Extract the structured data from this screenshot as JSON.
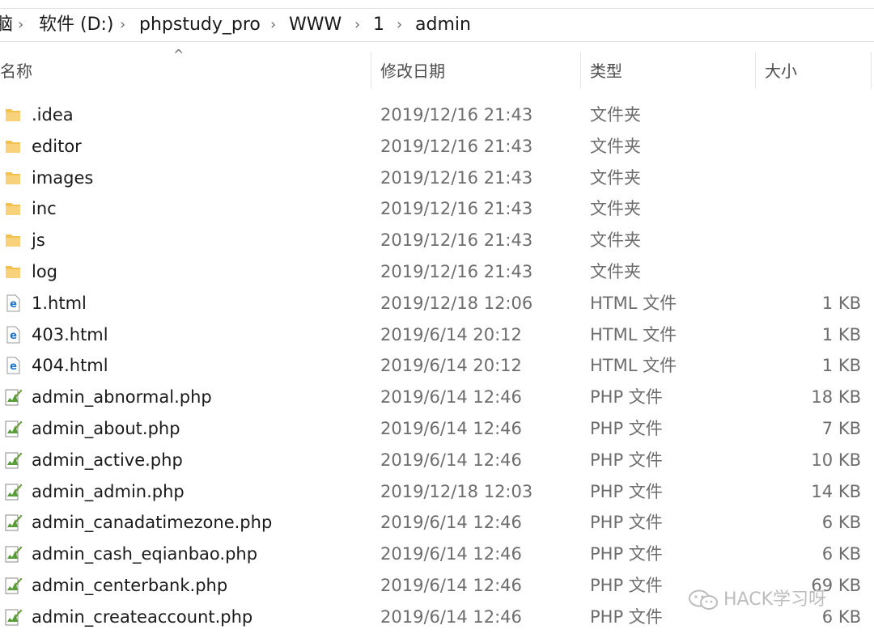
{
  "breadcrumb": {
    "items": [
      {
        "label": "脑"
      },
      {
        "label": "软件 (D:)"
      },
      {
        "label": "phpstudy_pro"
      },
      {
        "label": "WWW"
      },
      {
        "label": "1"
      },
      {
        "label": "admin"
      }
    ],
    "separator": "›"
  },
  "columns": {
    "name": "名称",
    "date": "修改日期",
    "type": "类型",
    "size": "大小"
  },
  "sort_indicator": "^",
  "files": [
    {
      "name": ".idea",
      "date": "2019/12/16 21:43",
      "type": "文件夹",
      "size": "",
      "icon": "folder-icon"
    },
    {
      "name": "editor",
      "date": "2019/12/16 21:43",
      "type": "文件夹",
      "size": "",
      "icon": "folder-icon"
    },
    {
      "name": "images",
      "date": "2019/12/16 21:43",
      "type": "文件夹",
      "size": "",
      "icon": "folder-icon"
    },
    {
      "name": "inc",
      "date": "2019/12/16 21:43",
      "type": "文件夹",
      "size": "",
      "icon": "folder-icon"
    },
    {
      "name": "js",
      "date": "2019/12/16 21:43",
      "type": "文件夹",
      "size": "",
      "icon": "folder-icon"
    },
    {
      "name": "log",
      "date": "2019/12/16 21:43",
      "type": "文件夹",
      "size": "",
      "icon": "folder-icon"
    },
    {
      "name": "1.html",
      "date": "2019/12/18 12:06",
      "type": "HTML 文件",
      "size": "1 KB",
      "icon": "html-file-icon"
    },
    {
      "name": "403.html",
      "date": "2019/6/14 20:12",
      "type": "HTML 文件",
      "size": "1 KB",
      "icon": "html-file-icon"
    },
    {
      "name": "404.html",
      "date": "2019/6/14 20:12",
      "type": "HTML 文件",
      "size": "1 KB",
      "icon": "html-file-icon"
    },
    {
      "name": "admin_abnormal.php",
      "date": "2019/6/14 12:46",
      "type": "PHP 文件",
      "size": "18 KB",
      "icon": "php-file-icon"
    },
    {
      "name": "admin_about.php",
      "date": "2019/6/14 12:46",
      "type": "PHP 文件",
      "size": "7 KB",
      "icon": "php-file-icon"
    },
    {
      "name": "admin_active.php",
      "date": "2019/6/14 12:46",
      "type": "PHP 文件",
      "size": "10 KB",
      "icon": "php-file-icon"
    },
    {
      "name": "admin_admin.php",
      "date": "2019/12/18 12:03",
      "type": "PHP 文件",
      "size": "14 KB",
      "icon": "php-file-icon"
    },
    {
      "name": "admin_canadatimezone.php",
      "date": "2019/6/14 12:46",
      "type": "PHP 文件",
      "size": "6 KB",
      "icon": "php-file-icon"
    },
    {
      "name": "admin_cash_eqianbao.php",
      "date": "2019/6/14 12:46",
      "type": "PHP 文件",
      "size": "6 KB",
      "icon": "php-file-icon"
    },
    {
      "name": "admin_centerbank.php",
      "date": "2019/6/14 12:46",
      "type": "PHP 文件",
      "size": "69 KB",
      "icon": "php-file-icon"
    },
    {
      "name": "admin_createaccount.php",
      "date": "2019/6/14 12:46",
      "type": "PHP 文件",
      "size": "6 KB",
      "icon": "php-file-icon"
    }
  ],
  "watermark": {
    "text": "HACK学习呀",
    "icon": "wechat-icon"
  },
  "colors": {
    "folder": "#f2c14e",
    "html_icon": "#1e73c8",
    "php_icon": "#5a9e3a"
  }
}
